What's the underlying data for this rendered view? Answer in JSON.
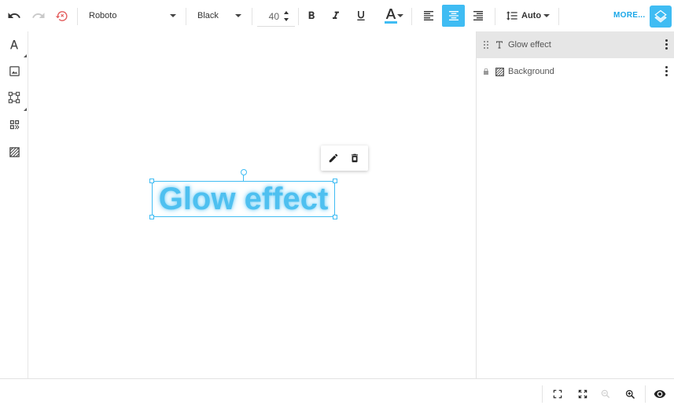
{
  "toolbar": {
    "font_family": "Roboto",
    "font_weight": "Black",
    "font_size": "40",
    "line_height": "Auto",
    "more_label": "MORE...",
    "text_color": "#3fbcf3"
  },
  "canvas": {
    "text": "Glow effect",
    "text_color": "#4ec0f0"
  },
  "layers": [
    {
      "name": "Glow effect",
      "type": "text-icon",
      "selected": true,
      "locked": false
    },
    {
      "name": "Background",
      "type": "background-icon",
      "selected": false,
      "locked": true
    }
  ],
  "colors": {
    "accent": "#3fbcf3",
    "link": "#1aa7e8"
  }
}
